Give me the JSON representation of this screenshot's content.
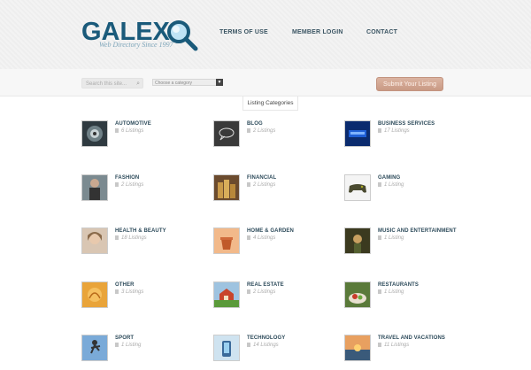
{
  "brand": {
    "name": "GALEXO",
    "tagline": "Web Directory Since 1997"
  },
  "nav": {
    "terms": "TERMS OF USE",
    "login": "MEMBER LOGIN",
    "contact": "CONTACT"
  },
  "search": {
    "placeholder": "Search this site...",
    "category_placeholder": "Choose a category",
    "submit_label": "Submit Your Listing"
  },
  "section_title": "Listing Categories",
  "categories": [
    {
      "name": "AUTOMOTIVE",
      "count": "6 Listings",
      "icon": "car-icon"
    },
    {
      "name": "BLOG",
      "count": "2 Listings",
      "icon": "blog-icon"
    },
    {
      "name": "BUSINESS SERVICES",
      "count": "17 Listings",
      "icon": "keyboard-icon"
    },
    {
      "name": "FASHION",
      "count": "2 Listings",
      "icon": "fashion-icon"
    },
    {
      "name": "FINANCIAL",
      "count": "2 Listings",
      "icon": "coins-icon"
    },
    {
      "name": "GAMING",
      "count": "1 Listing",
      "icon": "gamepad-icon"
    },
    {
      "name": "HEALTH & BEAUTY",
      "count": "18 Listings",
      "icon": "beauty-icon"
    },
    {
      "name": "HOME & GARDEN",
      "count": "4 Listings",
      "icon": "pot-icon"
    },
    {
      "name": "MUSIC AND ENTERTAINMENT",
      "count": "1 Listing",
      "icon": "music-icon"
    },
    {
      "name": "OTHER",
      "count": "3 Listings",
      "icon": "other-icon"
    },
    {
      "name": "REAL ESTATE",
      "count": "2 Listings",
      "icon": "house-icon"
    },
    {
      "name": "RESTAURANTS",
      "count": "1 Listing",
      "icon": "food-icon"
    },
    {
      "name": "SPORT",
      "count": "1 Listing",
      "icon": "sport-icon"
    },
    {
      "name": "TECHNOLOGY",
      "count": "14 Listings",
      "icon": "tech-icon"
    },
    {
      "name": "TRAVEL AND VACATIONS",
      "count": "11 Listings",
      "icon": "travel-icon"
    }
  ]
}
